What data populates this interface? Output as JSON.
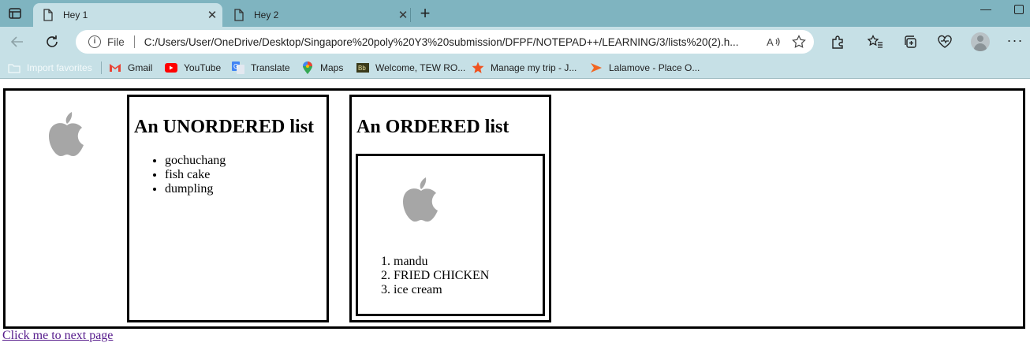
{
  "browser": {
    "tabs": [
      {
        "title": "Hey 1",
        "active": true
      },
      {
        "title": "Hey 2",
        "active": false
      }
    ],
    "address_bar": {
      "scheme_label": "File",
      "url": "C:/Users/User/OneDrive/Desktop/Singapore%20poly%20Y3%20submission/DFPF/NOTEPAD++/LEARNING/3/lists%20(2).h..."
    },
    "bookmarks": [
      {
        "label": "Import favorites",
        "icon": "import-icon"
      },
      {
        "label": "Gmail",
        "icon": "gmail-icon"
      },
      {
        "label": "YouTube",
        "icon": "youtube-icon"
      },
      {
        "label": "Translate",
        "icon": "translate-icon"
      },
      {
        "label": "Maps",
        "icon": "maps-icon"
      },
      {
        "label": "Welcome, TEW RO...",
        "icon": "site-icon"
      },
      {
        "label": "Manage my trip - J...",
        "icon": "star-icon"
      },
      {
        "label": "Lalamove - Place O...",
        "icon": "lalamove-icon"
      }
    ],
    "colors": {
      "tabbar": "#7fb4c0",
      "toolbar": "#c6e0e6"
    }
  },
  "page": {
    "unordered": {
      "heading": "An UNORDERED list",
      "items": [
        "gochuchang",
        "fish cake",
        "dumpling"
      ]
    },
    "ordered": {
      "heading": "An ORDERED list",
      "items": [
        "mandu",
        "FRIED CHICKEN",
        "ice cream"
      ]
    },
    "link_text": "Click me to next page",
    "logo_icon": "apple-logo-icon",
    "colors": {
      "logo": "#a6a6a6",
      "visited_link": "#551a8b"
    }
  }
}
